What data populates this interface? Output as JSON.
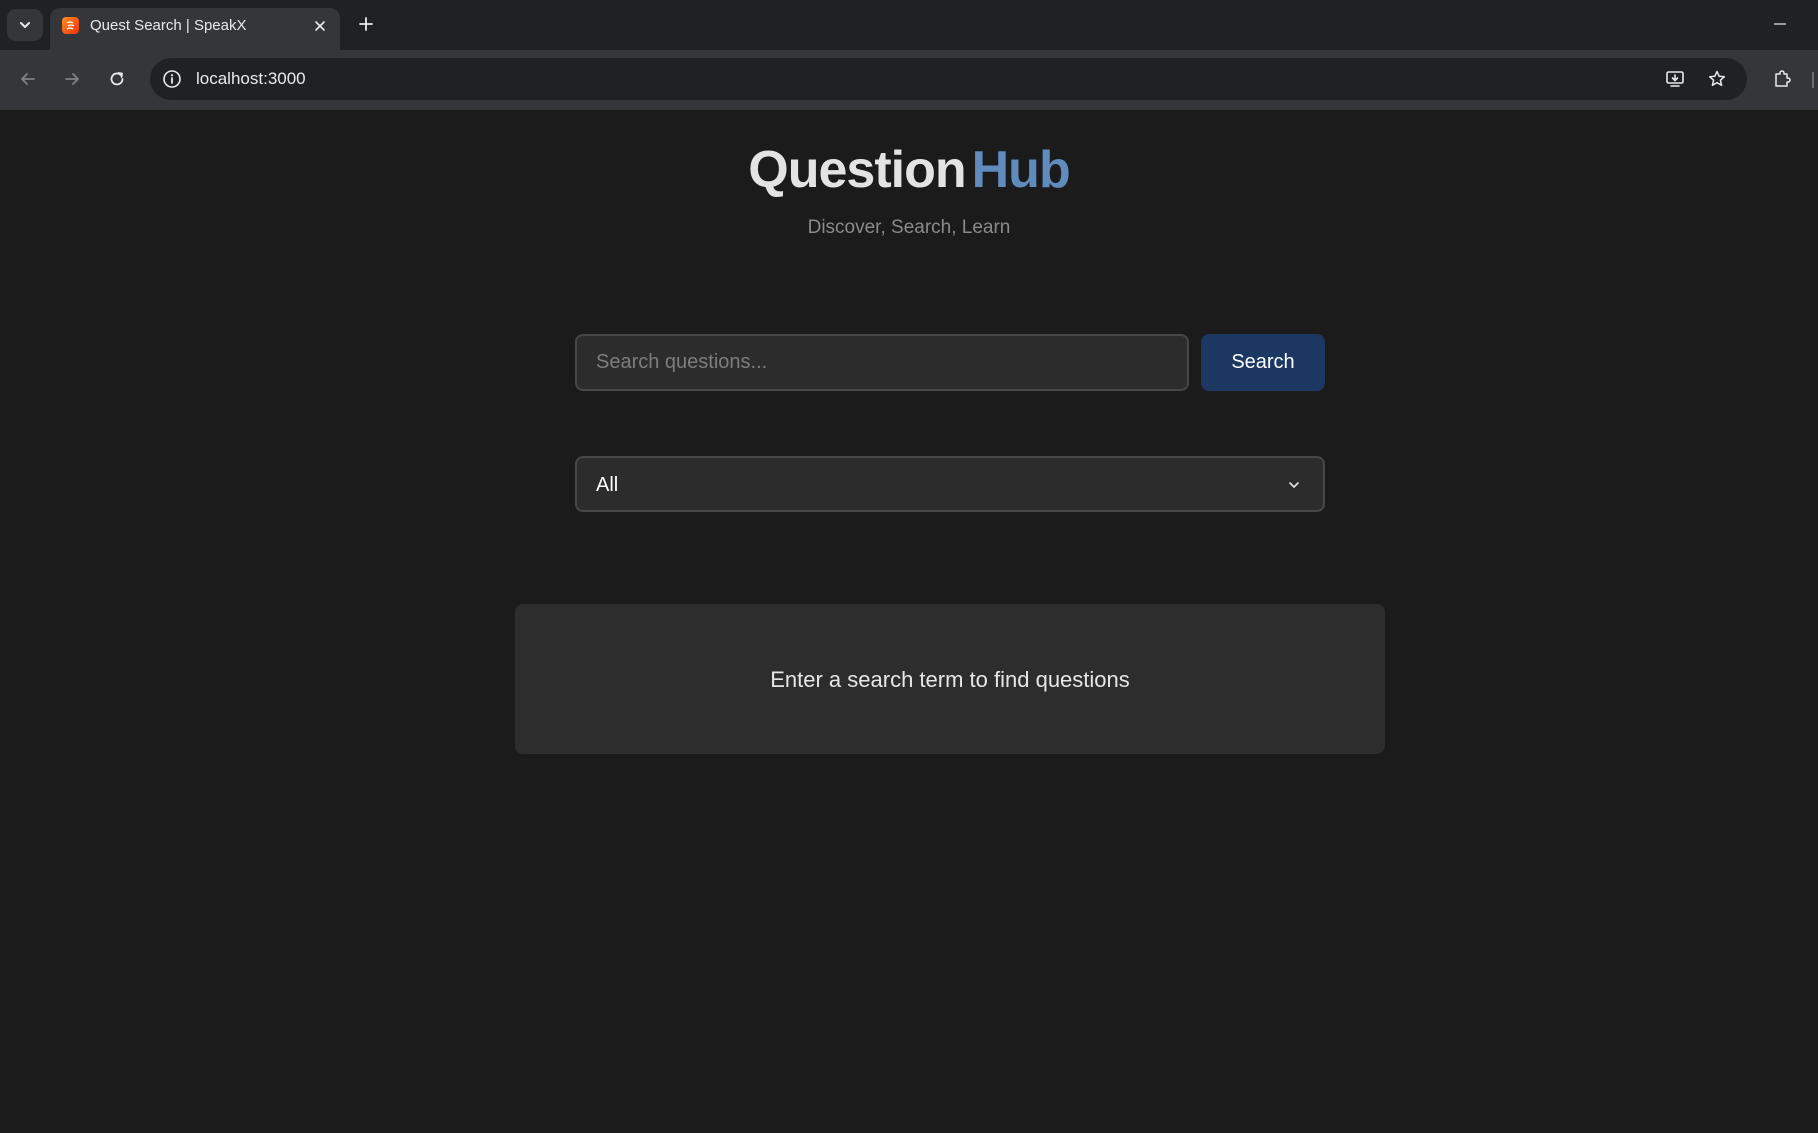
{
  "browser": {
    "tab_title": "Quest Search | SpeakX",
    "url": "localhost:3000",
    "favicon_icon": "speakx-favicon"
  },
  "header": {
    "logo_primary": "Question",
    "logo_accent": "Hub",
    "tagline": "Discover, Search, Learn"
  },
  "search": {
    "placeholder": "Search questions...",
    "value": "",
    "button_label": "Search"
  },
  "filter": {
    "selected": "All"
  },
  "results": {
    "empty_message": "Enter a search term to find questions"
  },
  "colors": {
    "background": "#1b1b1b",
    "accent": "#5f8bbd",
    "button": "#1b3762",
    "card": "#2d2d2d"
  }
}
